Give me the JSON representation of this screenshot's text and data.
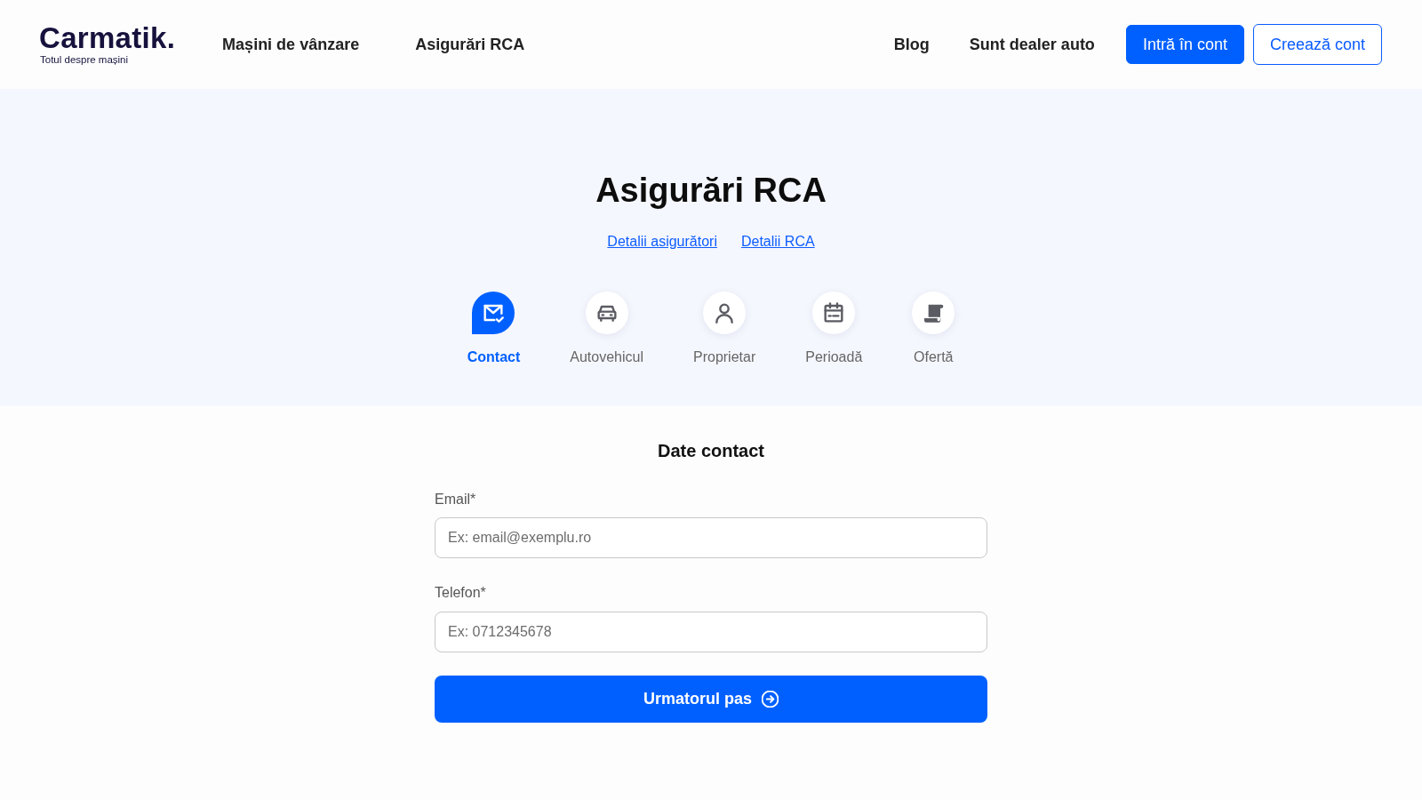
{
  "header": {
    "logo": {
      "wordmark": "Carmatik.",
      "tagline": "Totul despre mașini"
    },
    "nav_links": [
      {
        "label": "Mașini de vânzare"
      },
      {
        "label": "Asigurări RCA"
      }
    ],
    "right_links": [
      {
        "label": "Blog"
      },
      {
        "label": "Sunt dealer auto"
      }
    ],
    "buttons": [
      {
        "label": "Intră în cont",
        "kind": "primary"
      },
      {
        "label": "Creează cont",
        "kind": "outline"
      }
    ]
  },
  "hero": {
    "title": "Asigurări RCA",
    "links": [
      {
        "label": "Detalii asigurători"
      },
      {
        "label": "Detalii RCA"
      }
    ],
    "steps": [
      {
        "label": "Contact",
        "kind": "contact",
        "selected": true
      },
      {
        "label": "Autovehicul",
        "kind": "vehicle",
        "selected": false
      },
      {
        "label": "Proprietar",
        "kind": "owner",
        "selected": false
      },
      {
        "label": "Perioadă",
        "kind": "period",
        "selected": false
      },
      {
        "label": "Ofertă",
        "kind": "offer",
        "selected": false
      }
    ]
  },
  "form": {
    "title": "Date contact",
    "fields": [
      {
        "label": "Email*",
        "placeholder": "Ex: email@exemplu.ro"
      },
      {
        "label": "Telefon*",
        "placeholder": "Ex: 0712345678"
      }
    ],
    "submit": {
      "label": "Urmatorul pas"
    }
  }
}
